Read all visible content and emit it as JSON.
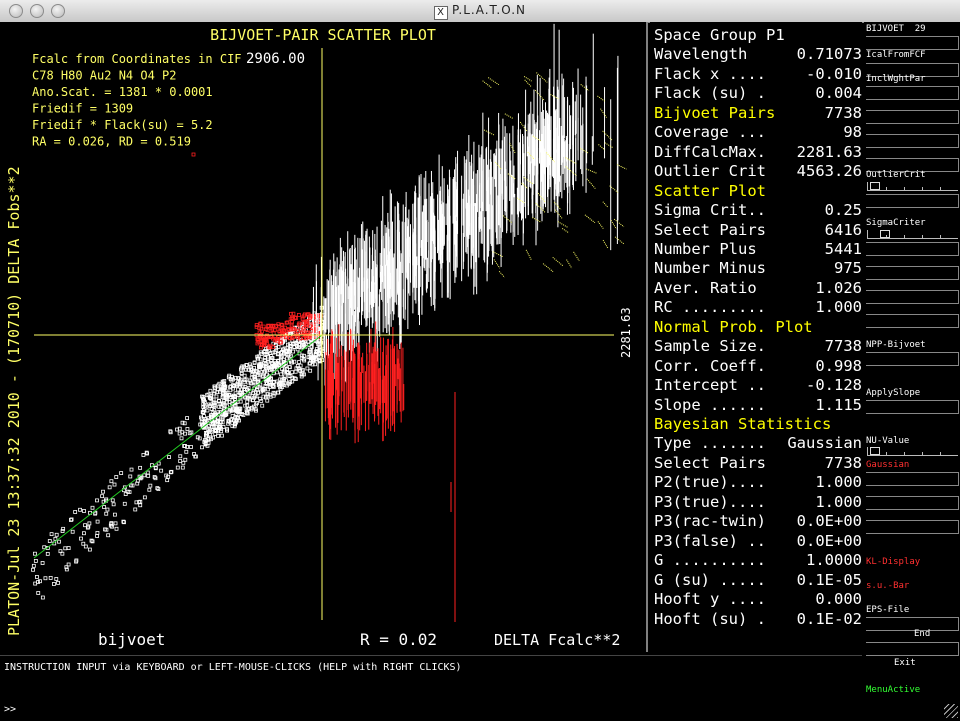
{
  "window": {
    "title": "P.L.A.T.O.N"
  },
  "plot": {
    "title": "BIJVOET-PAIR SCATTER PLOT",
    "y_axis_label": "PLATON-Jul 23 13:37:32 2010 - (170710)   DELTA Fobs**2",
    "x_axis_label": "DELTA Fcalc**2",
    "bottom_left": "bijvoet",
    "r_value": "R = 0.02",
    "x_max_label": "2906.00",
    "y_max_label": "2281.63",
    "info_lines": [
      "Fcalc from Coordinates in CIF",
      "C78 H80 Au2 N4 O4 P2",
      "Ano.Scat. =  1381 * 0.0001",
      "Friedif  =  1309",
      "Friedif * Flack(su) =  5.2",
      "RA = 0.026, RD = 0.519"
    ],
    "colors": {
      "axis": "#ffff66",
      "white_points": "#ffffff",
      "red_points": "#ff2020",
      "yellow_labels": "#ffff66",
      "fit_line": "#22cc22"
    }
  },
  "info_panel": {
    "rows": [
      {
        "k": "Space Group P1",
        "v": "",
        "head": false
      },
      {
        "k": "Wavelength",
        "v": "0.71073",
        "head": false
      },
      {
        "k": "Flack x ....",
        "v": "-0.010",
        "head": false
      },
      {
        "k": "Flack (su) .",
        "v": "0.004",
        "head": false
      },
      {
        "k": "Bijvoet Pairs",
        "v": "7738",
        "head": true
      },
      {
        "k": "Coverage ...",
        "v": "98",
        "head": false
      },
      {
        "k": "DiffCalcMax.",
        "v": "2281.63",
        "head": false
      },
      {
        "k": "Outlier Crit",
        "v": "4563.26",
        "head": false
      },
      {
        "k": "Scatter Plot",
        "v": "",
        "head": true
      },
      {
        "k": "Sigma Crit..",
        "v": "0.25",
        "head": false
      },
      {
        "k": "Select Pairs",
        "v": "6416",
        "head": false
      },
      {
        "k": "Number Plus",
        "v": "5441",
        "head": false
      },
      {
        "k": "Number Minus",
        "v": "975",
        "head": false
      },
      {
        "k": "Aver. Ratio",
        "v": "1.026",
        "head": false
      },
      {
        "k": "RC .........",
        "v": "1.000",
        "head": false
      },
      {
        "k": "Normal Prob. Plot",
        "v": "",
        "head": true
      },
      {
        "k": "Sample Size.",
        "v": "7738",
        "head": false
      },
      {
        "k": "Corr. Coeff.",
        "v": "0.998",
        "head": false
      },
      {
        "k": "Intercept ..",
        "v": "-0.128",
        "head": false
      },
      {
        "k": "Slope ......",
        "v": "1.115",
        "head": false
      },
      {
        "k": "Bayesian Statistics",
        "v": "",
        "head": true
      },
      {
        "k": "Type .......",
        "v": "Gaussian",
        "head": false
      },
      {
        "k": "Select Pairs",
        "v": "7738",
        "head": false
      },
      {
        "k": "P2(true)....",
        "v": "1.000",
        "head": false
      },
      {
        "k": "P3(true)....",
        "v": "1.000",
        "head": false
      },
      {
        "k": "P3(rac-twin)",
        "v": "0.0E+00",
        "head": false
      },
      {
        "k": "P3(false) ..",
        "v": "0.0E+00",
        "head": false
      },
      {
        "k": "G ..........",
        "v": "1.0000",
        "head": false
      },
      {
        "k": "G (su) .....",
        "v": "0.1E-05",
        "head": false
      },
      {
        "k": "Hooft y ....",
        "v": "0.000",
        "head": false
      },
      {
        "k": "Hooft (su) .",
        "v": "0.1E-02",
        "head": false
      }
    ]
  },
  "menu": {
    "header": "BIJVOET  29",
    "items": {
      "icalc": "IcalFromFCF",
      "inclwght": "InclWghtPar",
      "outlier": "OutlierCrit",
      "sigma": "SigmaCriter",
      "npp": "NPP-Bijvoet",
      "slope": "ApplySlope",
      "nu": "NU-Value",
      "gaussian": "Gaussian",
      "kl": "KL-Display",
      "su": "s.u.-Bar",
      "eps": "EPS-File",
      "end": "End",
      "exit": "Exit",
      "active": "MenuActive"
    },
    "colors": {
      "normal": "#ffffff",
      "highlight": "#ff3030",
      "active": "#33ff33"
    }
  },
  "command": {
    "instruction": "INSTRUCTION INPUT via KEYBOARD or LEFT-MOUSE-CLICKS (HELP with RIGHT CLICKS)",
    "prompt": ">>"
  }
}
